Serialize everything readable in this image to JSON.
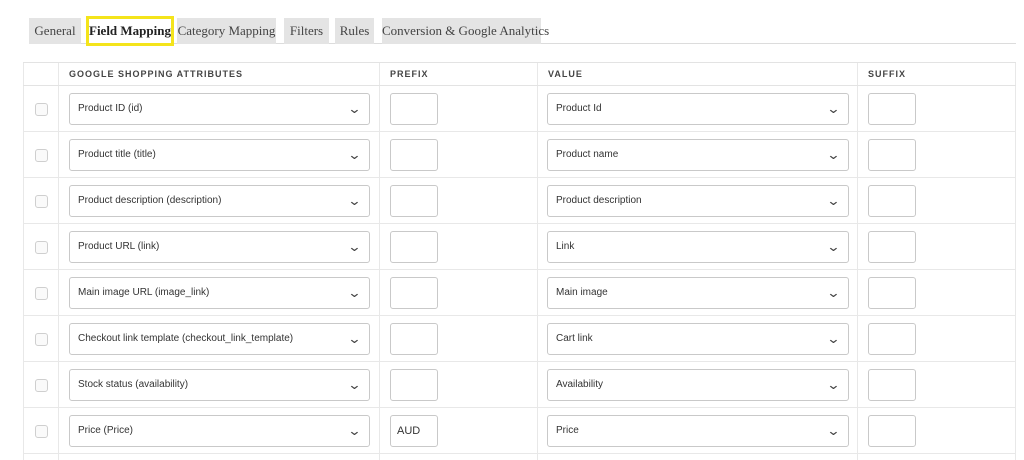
{
  "tabs": [
    {
      "label": "General"
    },
    {
      "label": "Field Mapping",
      "active": true
    },
    {
      "label": "Category Mapping"
    },
    {
      "label": "Filters"
    },
    {
      "label": "Rules"
    },
    {
      "label": "Conversion & Google Analytics"
    }
  ],
  "columns": {
    "attributes": "GOOGLE SHOPPING ATTRIBUTES",
    "prefix": "PREFIX",
    "value": "VALUE",
    "suffix": "SUFFIX"
  },
  "rows": [
    {
      "attribute": "Product ID (id)",
      "prefix": "",
      "value": "Product Id",
      "suffix": ""
    },
    {
      "attribute": "Product title (title)",
      "prefix": "",
      "value": "Product name",
      "suffix": ""
    },
    {
      "attribute": "Product description (description)",
      "prefix": "",
      "value": "Product description",
      "suffix": ""
    },
    {
      "attribute": "Product URL (link)",
      "prefix": "",
      "value": "Link",
      "suffix": ""
    },
    {
      "attribute": "Main image URL (image_link)",
      "prefix": "",
      "value": "Main image",
      "suffix": ""
    },
    {
      "attribute": "Checkout link template (checkout_link_template)",
      "prefix": "",
      "value": "Cart link",
      "suffix": ""
    },
    {
      "attribute": "Stock status (availability)",
      "prefix": "",
      "value": "Availability",
      "suffix": ""
    },
    {
      "attribute": "Price (Price)",
      "prefix": "AUD",
      "value": "Price",
      "suffix": ""
    }
  ],
  "colors": {
    "active_tab_border": "#f4e41b",
    "tab_bg": "#e4e4e4"
  },
  "icons": {
    "dropdown": "chevron-down-icon"
  }
}
